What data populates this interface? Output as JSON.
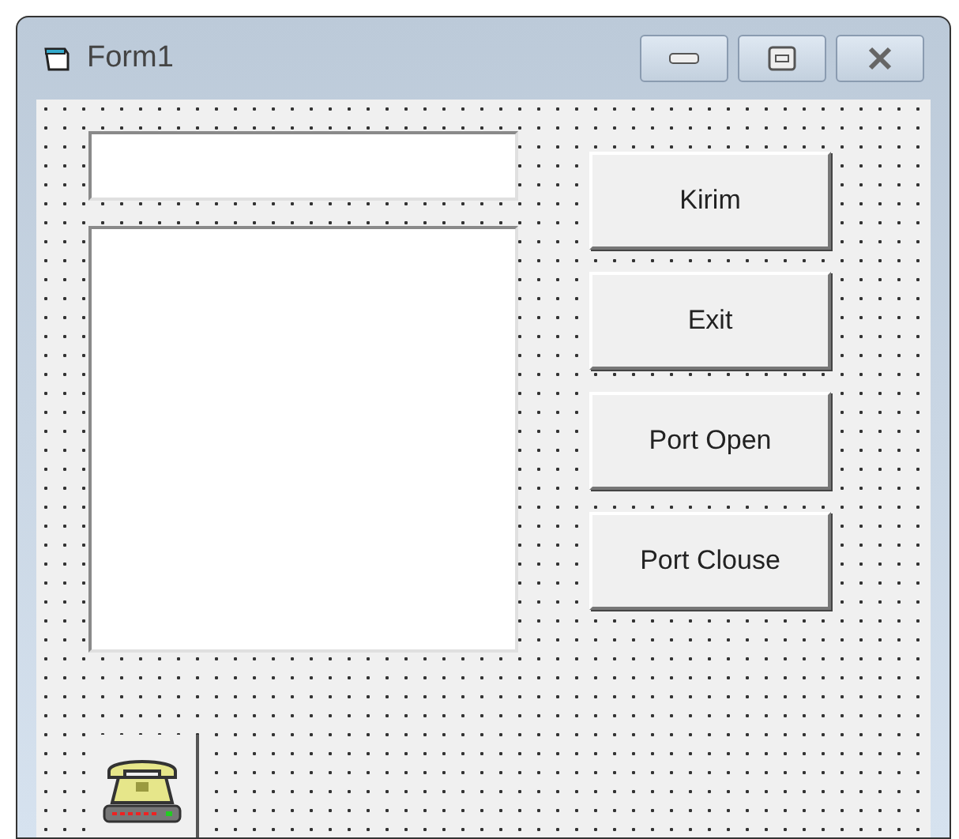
{
  "window": {
    "title": "Form1"
  },
  "buttons": [
    {
      "label": "Kirim"
    },
    {
      "label": "Exit"
    },
    {
      "label": "Port Open"
    },
    {
      "label": "Port Clouse"
    }
  ]
}
